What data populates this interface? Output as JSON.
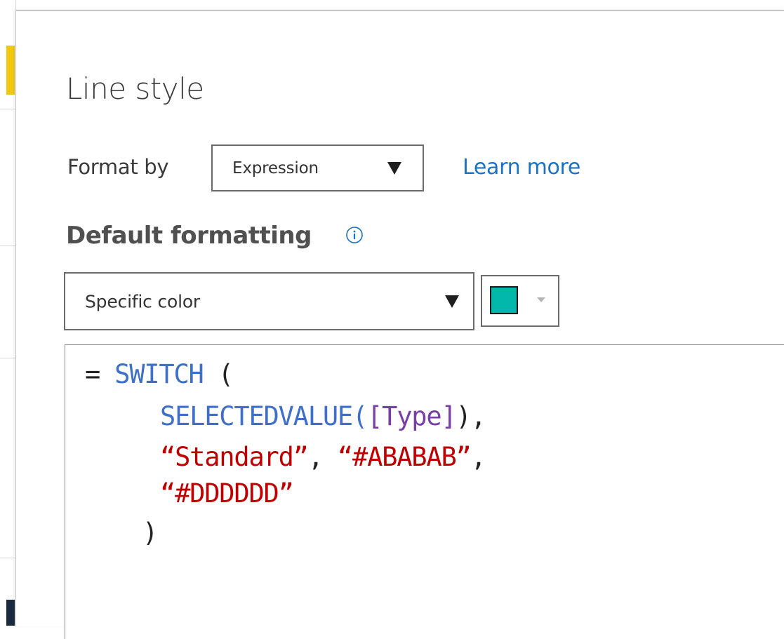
{
  "dialog": {
    "title": "Line style",
    "format_by": {
      "label": "Format by",
      "selected": "Expression"
    },
    "learn_more": "Learn more",
    "default_formatting": {
      "label": "Default formatting",
      "info_icon": "info-icon",
      "mode_selected": "Specific color",
      "swatch_color": "#01B8AA"
    },
    "expression": {
      "eq": "=",
      "switch": "SWITCH",
      "open_paren": "(",
      "selectedvalue": "SELECTEDVALUE(",
      "column": "[Type]",
      "selectedvalue_close": "),",
      "str_standard": "“Standard”",
      "comma": ",",
      "str_ababab": "“#ABABAB”",
      "comma2": ",",
      "str_dddddd": "“#DDDDDD”",
      "close_paren": ")"
    }
  },
  "colors": {
    "keyword": "#3E6FC9",
    "column": "#7A3FA6",
    "string": "#C00000",
    "link": "#1A73C8"
  }
}
